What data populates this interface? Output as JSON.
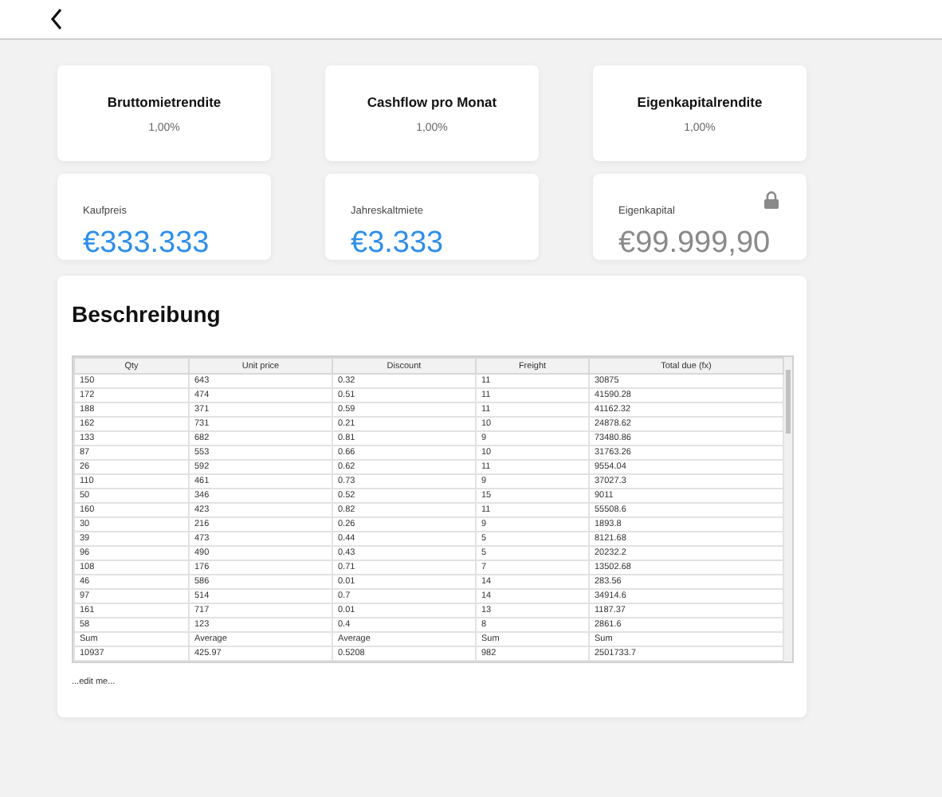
{
  "metrics": [
    {
      "title": "Bruttomietrendite",
      "value": "1,00%"
    },
    {
      "title": "Cashflow pro Monat",
      "value": "1,00%"
    },
    {
      "title": "Eigenkapitalrendite",
      "value": "1,00%"
    }
  ],
  "inputs": [
    {
      "label": "Kaufpreis",
      "value": "€333.333",
      "locked": false
    },
    {
      "label": "Jahreskaltmiete",
      "value": "€3.333",
      "locked": false
    },
    {
      "label": "Eigenkapital",
      "value": "€99.999,90",
      "locked": true
    }
  ],
  "description": {
    "title": "Beschreibung",
    "table": {
      "columns": [
        "Qty",
        "Unit price",
        "Discount",
        "Freight",
        "Total due (fx)"
      ],
      "rows": [
        [
          "150",
          "643",
          "0.32",
          "11",
          "30875"
        ],
        [
          "172",
          "474",
          "0.51",
          "11",
          "41590.28"
        ],
        [
          "188",
          "371",
          "0.59",
          "11",
          "41162.32"
        ],
        [
          "162",
          "731",
          "0.21",
          "10",
          "24878.62"
        ],
        [
          "133",
          "682",
          "0.81",
          "9",
          "73480.86"
        ],
        [
          "87",
          "553",
          "0.66",
          "10",
          "31763.26"
        ],
        [
          "26",
          "592",
          "0.62",
          "11",
          "9554.04"
        ],
        [
          "110",
          "461",
          "0.73",
          "9",
          "37027.3"
        ],
        [
          "50",
          "346",
          "0.52",
          "15",
          "9011"
        ],
        [
          "160",
          "423",
          "0.82",
          "11",
          "55508.6"
        ],
        [
          "30",
          "216",
          "0.26",
          "9",
          "1893.8"
        ],
        [
          "39",
          "473",
          "0.44",
          "5",
          "8121.68"
        ],
        [
          "96",
          "490",
          "0.43",
          "5",
          "20232.2"
        ],
        [
          "108",
          "176",
          "0.71",
          "7",
          "13502.68"
        ],
        [
          "46",
          "586",
          "0.01",
          "14",
          "283.56"
        ],
        [
          "97",
          "514",
          "0.7",
          "14",
          "34914.6"
        ],
        [
          "161",
          "717",
          "0.01",
          "13",
          "1187.37"
        ],
        [
          "58",
          "123",
          "0.4",
          "8",
          "2861.6"
        ]
      ],
      "footer": [
        [
          "Sum",
          "Average",
          "Average",
          "Sum",
          "Sum"
        ],
        [
          "10937",
          "425.97",
          "0.5208",
          "982",
          "2501733.7"
        ]
      ]
    },
    "note": "...edit me..."
  }
}
